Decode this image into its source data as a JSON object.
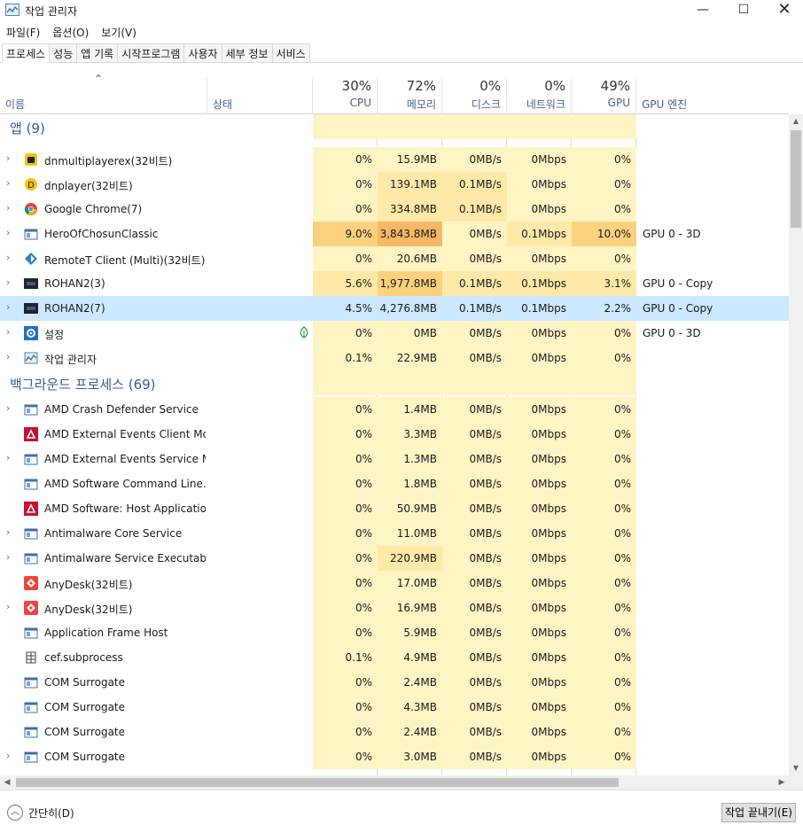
{
  "window": {
    "title": "작업 관리자",
    "minimize": "—",
    "maximize": "☐",
    "close": "✕"
  },
  "menu": [
    "파일(F)",
    "옵션(O)",
    "보기(V)"
  ],
  "tabs": [
    "프로세스",
    "성능",
    "앱 기록",
    "시작프로그램",
    "사용자",
    "세부 정보",
    "서비스"
  ],
  "active_tab": 0,
  "header": {
    "name": "이름",
    "status": "상태",
    "cpu_pct": "30%",
    "cpu": "CPU",
    "mem_pct": "72%",
    "mem": "메모리",
    "disk_pct": "0%",
    "disk": "디스크",
    "net_pct": "0%",
    "net": "네트워크",
    "gpu_pct": "49%",
    "gpu": "GPU",
    "gpu_engine": "GPU 엔진"
  },
  "colors": {
    "heat_light": "#fff4c4",
    "heat_mid": "#ffe9a8",
    "heat_high": "#fbd17e",
    "heat_strong": "#f7b865",
    "selected": "#cce8ff",
    "group": "#2f5da0"
  },
  "groups": {
    "apps": "앱 (9)",
    "background": "백그라운드 프로세스 (69)"
  },
  "apps": [
    {
      "name": "dnmultiplayerex(32비트)",
      "icon": "dnmulti-icon",
      "exp": true,
      "cpu": "0%",
      "mem": "15.9MB",
      "disk": "0MB/s",
      "net": "0Mbps",
      "gpu": "0%",
      "engine": ""
    },
    {
      "name": "dnplayer(32비트)",
      "icon": "dnplayer-icon",
      "exp": true,
      "cpu": "0%",
      "mem": "139.1MB",
      "disk": "0.1MB/s",
      "net": "0Mbps",
      "gpu": "0%",
      "engine": ""
    },
    {
      "name": "Google Chrome(7)",
      "icon": "chrome-icon",
      "exp": true,
      "cpu": "0%",
      "mem": "334.8MB",
      "disk": "0.1MB/s",
      "net": "0Mbps",
      "gpu": "0%",
      "engine": ""
    },
    {
      "name": "HeroOfChosunClassic",
      "icon": "window-icon",
      "exp": true,
      "cpu": "9.0%",
      "mem": "3,843.8MB",
      "disk": "0MB/s",
      "net": "0.1Mbps",
      "gpu": "10.0%",
      "engine": "GPU 0 - 3D"
    },
    {
      "name": "RemoteT Client (Multi)(32비트)...",
      "icon": "remotet-icon",
      "exp": true,
      "cpu": "0%",
      "mem": "20.6MB",
      "disk": "0MB/s",
      "net": "0Mbps",
      "gpu": "0%",
      "engine": ""
    },
    {
      "name": "ROHAN2(3)",
      "icon": "rohan-icon",
      "exp": true,
      "cpu": "5.6%",
      "mem": "1,977.8MB",
      "disk": "0.1MB/s",
      "net": "0.1Mbps",
      "gpu": "3.1%",
      "engine": "GPU 0 - Copy"
    },
    {
      "name": "ROHAN2(7)",
      "icon": "rohan-icon",
      "exp": true,
      "cpu": "4.5%",
      "mem": "4,276.8MB",
      "disk": "0.1MB/s",
      "net": "0.1Mbps",
      "gpu": "2.2%",
      "engine": "GPU 0 - Copy",
      "selected": true
    },
    {
      "name": "설정",
      "icon": "settings-icon",
      "exp": true,
      "cpu": "0%",
      "mem": "0MB",
      "disk": "0MB/s",
      "net": "0Mbps",
      "gpu": "0%",
      "engine": "GPU 0 - 3D",
      "leaf": true
    },
    {
      "name": "작업 관리자",
      "icon": "taskmgr-icon",
      "exp": true,
      "cpu": "0.1%",
      "mem": "22.9MB",
      "disk": "0MB/s",
      "net": "0Mbps",
      "gpu": "0%",
      "engine": ""
    }
  ],
  "background": [
    {
      "name": "AMD Crash Defender Service",
      "icon": "window-icon",
      "exp": true,
      "cpu": "0%",
      "mem": "1.4MB",
      "disk": "0MB/s",
      "net": "0Mbps",
      "gpu": "0%"
    },
    {
      "name": "AMD External Events Client Mo...",
      "icon": "amd-icon",
      "exp": false,
      "cpu": "0%",
      "mem": "3.3MB",
      "disk": "0MB/s",
      "net": "0Mbps",
      "gpu": "0%"
    },
    {
      "name": "AMD External Events Service M...",
      "icon": "window-icon",
      "exp": true,
      "cpu": "0%",
      "mem": "1.3MB",
      "disk": "0MB/s",
      "net": "0Mbps",
      "gpu": "0%"
    },
    {
      "name": "AMD Software Command Line...",
      "icon": "window-icon",
      "exp": false,
      "cpu": "0%",
      "mem": "1.8MB",
      "disk": "0MB/s",
      "net": "0Mbps",
      "gpu": "0%"
    },
    {
      "name": "AMD Software: Host Application",
      "icon": "amd-icon",
      "exp": false,
      "cpu": "0%",
      "mem": "50.9MB",
      "disk": "0MB/s",
      "net": "0Mbps",
      "gpu": "0%"
    },
    {
      "name": "Antimalware Core Service",
      "icon": "window-icon",
      "exp": true,
      "cpu": "0%",
      "mem": "11.0MB",
      "disk": "0MB/s",
      "net": "0Mbps",
      "gpu": "0%"
    },
    {
      "name": "Antimalware Service Executable",
      "icon": "window-icon",
      "exp": true,
      "cpu": "0%",
      "mem": "220.9MB",
      "disk": "0MB/s",
      "net": "0Mbps",
      "gpu": "0%"
    },
    {
      "name": "AnyDesk(32비트)",
      "icon": "anydesk-icon",
      "exp": false,
      "cpu": "0%",
      "mem": "17.0MB",
      "disk": "0MB/s",
      "net": "0Mbps",
      "gpu": "0%"
    },
    {
      "name": "AnyDesk(32비트)",
      "icon": "anydesk-icon",
      "exp": true,
      "cpu": "0%",
      "mem": "16.9MB",
      "disk": "0MB/s",
      "net": "0Mbps",
      "gpu": "0%"
    },
    {
      "name": "Application Frame Host",
      "icon": "window-icon",
      "exp": false,
      "cpu": "0%",
      "mem": "5.9MB",
      "disk": "0MB/s",
      "net": "0Mbps",
      "gpu": "0%"
    },
    {
      "name": "cef.subprocess",
      "icon": "cef-icon",
      "exp": false,
      "cpu": "0.1%",
      "mem": "4.9MB",
      "disk": "0MB/s",
      "net": "0Mbps",
      "gpu": "0%"
    },
    {
      "name": "COM Surrogate",
      "icon": "window-icon",
      "exp": false,
      "cpu": "0%",
      "mem": "2.4MB",
      "disk": "0MB/s",
      "net": "0Mbps",
      "gpu": "0%"
    },
    {
      "name": "COM Surrogate",
      "icon": "window-icon",
      "exp": false,
      "cpu": "0%",
      "mem": "4.3MB",
      "disk": "0MB/s",
      "net": "0Mbps",
      "gpu": "0%"
    },
    {
      "name": "COM Surrogate",
      "icon": "window-icon",
      "exp": false,
      "cpu": "0%",
      "mem": "2.4MB",
      "disk": "0MB/s",
      "net": "0Mbps",
      "gpu": "0%"
    },
    {
      "name": "COM Surrogate",
      "icon": "window-icon",
      "exp": true,
      "cpu": "0%",
      "mem": "3.0MB",
      "disk": "0MB/s",
      "net": "0Mbps",
      "gpu": "0%"
    }
  ],
  "footer": {
    "fewer_details": "간단히(D)",
    "end_task": "작업 끝내기(E)"
  }
}
